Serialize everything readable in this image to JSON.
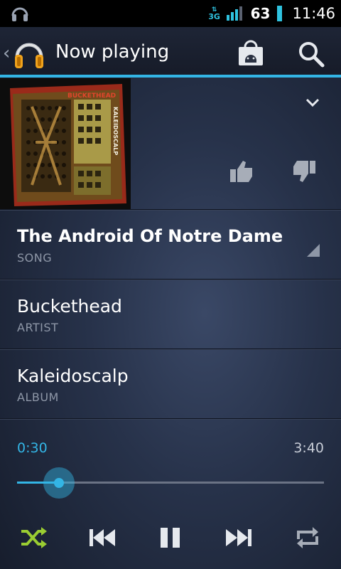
{
  "status_bar": {
    "network": "3G",
    "battery_percent": "63",
    "time": "11:46"
  },
  "action_bar": {
    "title": "Now playing",
    "icons": [
      "headphones-icon",
      "shop-icon",
      "search-icon"
    ]
  },
  "track": {
    "song": "The Android Of Notre Dame",
    "song_label": "SONG",
    "artist": "Buckethead",
    "artist_label": "ARTIST",
    "album": "Kaleidoscalp",
    "album_label": "ALBUM"
  },
  "album_art": {
    "band_text": "BUCKETHEAD",
    "album_text": "KALEIDOSCALP"
  },
  "progress": {
    "current": "0:30",
    "total": "3:40",
    "fraction": 0.136
  },
  "colors": {
    "accent": "#33b5e5",
    "shuffle_active": "#9acd32"
  }
}
